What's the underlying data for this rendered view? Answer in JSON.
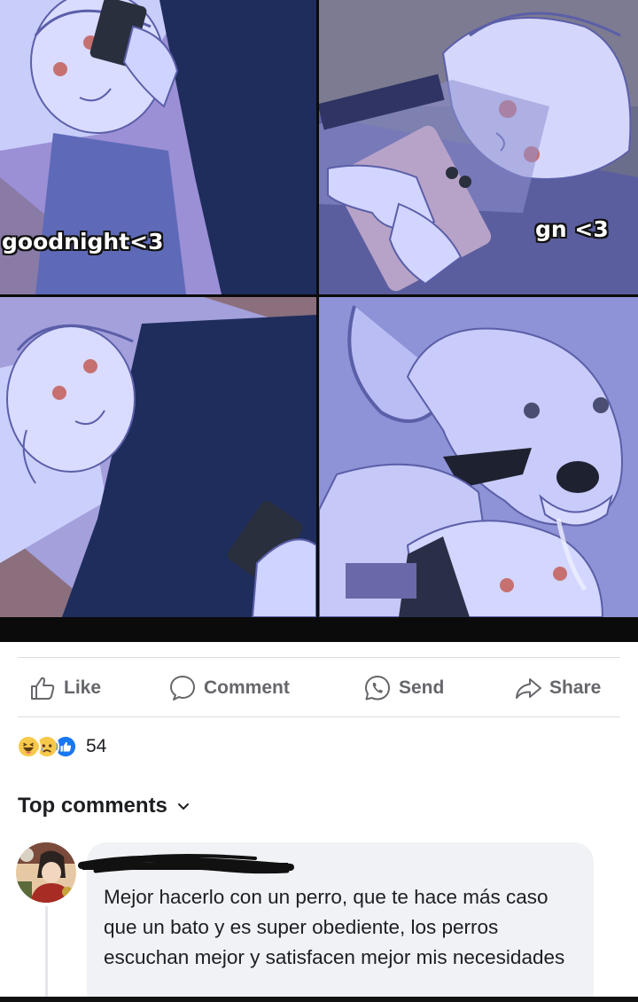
{
  "post": {
    "meme": {
      "panels": [
        {
          "caption": "goodnight<3"
        },
        {
          "caption": "gn <3"
        },
        {
          "caption": ""
        },
        {
          "caption": ""
        }
      ]
    },
    "actions": {
      "like": "Like",
      "comment": "Comment",
      "send": "Send",
      "share": "Share"
    },
    "reactions": {
      "types": [
        "haha",
        "sad",
        "like"
      ],
      "count": "54"
    },
    "comments_header": "Top comments",
    "comments": [
      {
        "author": "",
        "text": "Mejor hacerlo con un perro, que te hace más caso que un bato y es super obediente, los perros escuchan mejor y satisfacen mejor mis necesidades"
      }
    ]
  },
  "colors": {
    "accent": "#1877f2",
    "muted_text": "#65676b",
    "bubble_bg": "#f0f2f5",
    "comic_tint": "#8d92e0"
  }
}
